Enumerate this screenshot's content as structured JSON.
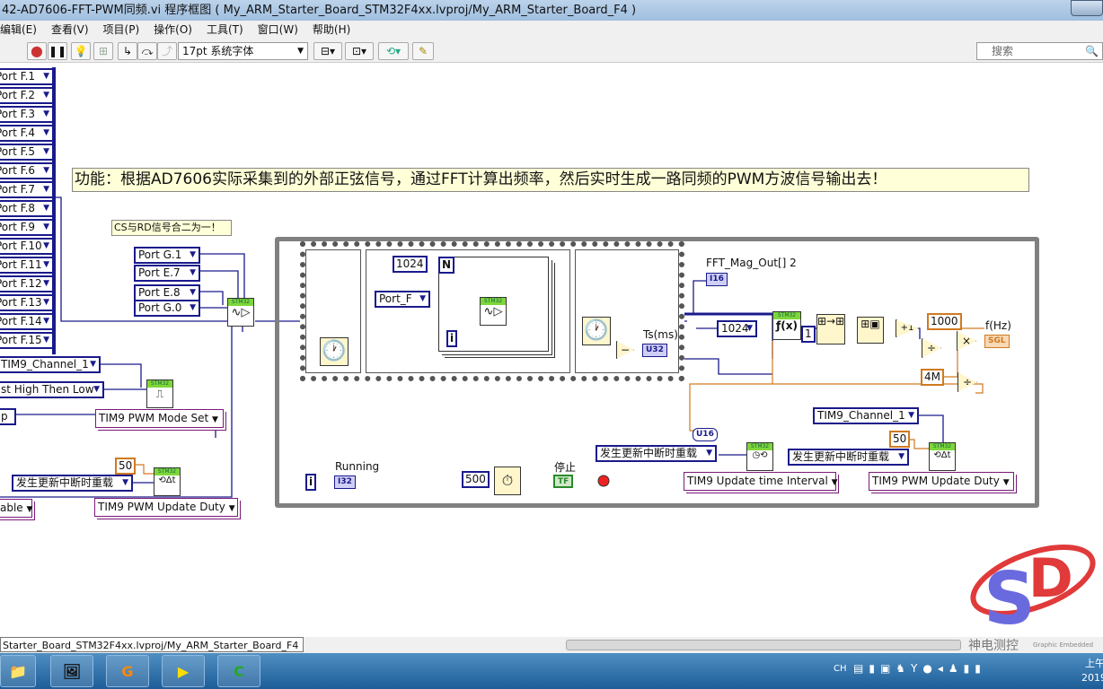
{
  "window": {
    "title": "42-AD7606-FFT-PWM同频.vi 程序框图 ( My_ARM_Starter_Board_STM32F4xx.lvproj/My_ARM_Starter_Board_F4 )"
  },
  "menu": [
    "编辑(E)",
    "查看(V)",
    "项目(P)",
    "操作(O)",
    "工具(T)",
    "窗口(W)",
    "帮助(H)"
  ],
  "toolbar": {
    "font": "17pt 系统字体",
    "search_placeholder": "搜索"
  },
  "left_ports": [
    "Port F.1",
    "Port F.2",
    "Port F.3",
    "Port F.4",
    "Port F.5",
    "Port F.6",
    "Port F.7",
    "Port F.8",
    "Port F.9",
    "Port F.10",
    "Port F.11",
    "Port F.12",
    "Port F.13",
    "Port F.14",
    "Port F.15"
  ],
  "comments": {
    "main": "功能：根据AD7606实际采集到的外部正弦信号，通过FFT计算出频率，然后实时生成一路同频的PWM方波信号输出去！",
    "cs": "CS与RD信号合二为一！"
  },
  "cs_ports": [
    "Port G.1",
    "Port E.7",
    "Port E.8",
    "Port G.0"
  ],
  "left_lower": {
    "channel": "TIM9_Channel_1",
    "mode": "st High Then Low",
    "p": "p",
    "mode_set": "TIM9 PWM Mode Set",
    "duty_value": "50",
    "reload": "发生更新中断时重载",
    "able": "able",
    "update_duty": "TIM9 PWM Update Duty"
  },
  "sequence": {
    "n_const": "1024",
    "n_label": "N",
    "port": "Port_F",
    "i_label": "i",
    "ts_label": "Ts(ms)",
    "ts_type": "U32"
  },
  "fft": {
    "out_label": "FFT_Mag_Out[] 2",
    "out_type": "I16",
    "size": "1024",
    "one": "1",
    "fx": "ƒ(x)",
    "plus1": "+1",
    "k1000": "1000",
    "freq_label": "f(Hz)",
    "freq_type": "SGL",
    "k4m": "4M",
    "u16": "U16"
  },
  "right_lower": {
    "channel": "TIM9_Channel_1",
    "duty_value": "50",
    "reload1": "发生更新中断时重载",
    "reload2": "发生更新中断时重载",
    "interval": "TIM9 Update time Interval",
    "update_duty": "TIM9 PWM Update Duty"
  },
  "loop": {
    "i_label": "i",
    "running_label": "Running",
    "running_type": "I32",
    "wait_ms": "500",
    "stop_label": "停止",
    "stop_type": "TF"
  },
  "stm_label": "STM32",
  "statusbar": {
    "path": "Starter_Board_STM32F4xx.lvproj/My_ARM_Starter_Board_F4"
  },
  "logo": {
    "letters": "SD",
    "text": "神电测控",
    "sub": "Graphic Embedded"
  },
  "tray": {
    "lang": "CH",
    "time": "上午",
    "date": "2019"
  },
  "colors": {
    "wire_blue": "#1a1a8c",
    "wire_orange": "#d07a20",
    "loop_gray": "#808080"
  }
}
